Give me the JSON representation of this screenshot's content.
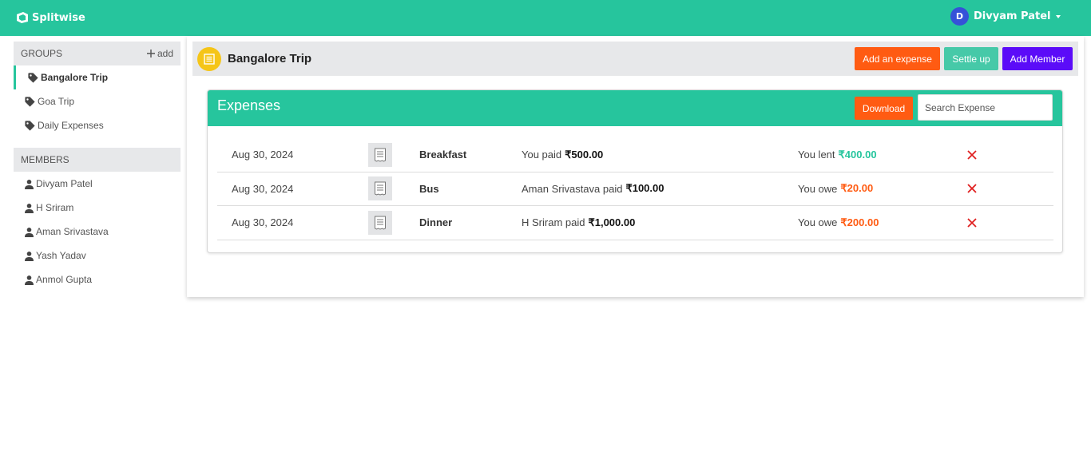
{
  "app": {
    "name": "Splitwise"
  },
  "user": {
    "initial": "D",
    "name": "Divyam Patel"
  },
  "sidebar": {
    "groups_label": "GROUPS",
    "add_label": "add",
    "groups": [
      {
        "label": "Bangalore Trip",
        "active": true
      },
      {
        "label": "Goa Trip",
        "active": false
      },
      {
        "label": "Daily Expenses",
        "active": false
      }
    ],
    "members_label": "MEMBERS",
    "members": [
      "Divyam Patel",
      "H Sriram",
      "Aman Srivastava",
      "Yash Yadav",
      "Anmol Gupta"
    ]
  },
  "group": {
    "title": "Bangalore Trip",
    "add_expense_label": "Add an expense",
    "settle_up_label": "Settle up",
    "add_member_label": "Add Member"
  },
  "expenses": {
    "title": "Expenses",
    "download_label": "Download",
    "search_placeholder": "Search Expense",
    "rows": [
      {
        "date": "Aug 30, 2024",
        "name": "Breakfast",
        "payer_text": "You paid",
        "paid_amount": "₹500.00",
        "balance_text": "You lent",
        "balance_amount": "₹400.00",
        "balance_type": "lent"
      },
      {
        "date": "Aug 30, 2024",
        "name": "Bus",
        "payer_text": "Aman Srivastava paid",
        "paid_amount": "₹100.00",
        "balance_text": "You owe",
        "balance_amount": "₹20.00",
        "balance_type": "owe"
      },
      {
        "date": "Aug 30, 2024",
        "name": "Dinner",
        "payer_text": "H Sriram paid",
        "paid_amount": "₹1,000.00",
        "balance_text": "You owe",
        "balance_amount": "₹200.00",
        "balance_type": "owe"
      }
    ]
  },
  "colors": {
    "brand": "#26c59d",
    "lent": "#26c59d",
    "owe": "#ff5b12",
    "delete": "#e02020",
    "add_expense_button": "#ff5b12",
    "settle_up_button": "#46c9a8",
    "add_member_button": "#5b0cf8",
    "group_icon": "#f5c518",
    "avatar": "#3552d8"
  },
  "icons": {
    "logo": "splitwise-logo-icon",
    "group": "list-icon",
    "tag": "tag-icon",
    "member": "person-icon",
    "receipt": "receipt-icon",
    "delete": "close-icon"
  }
}
